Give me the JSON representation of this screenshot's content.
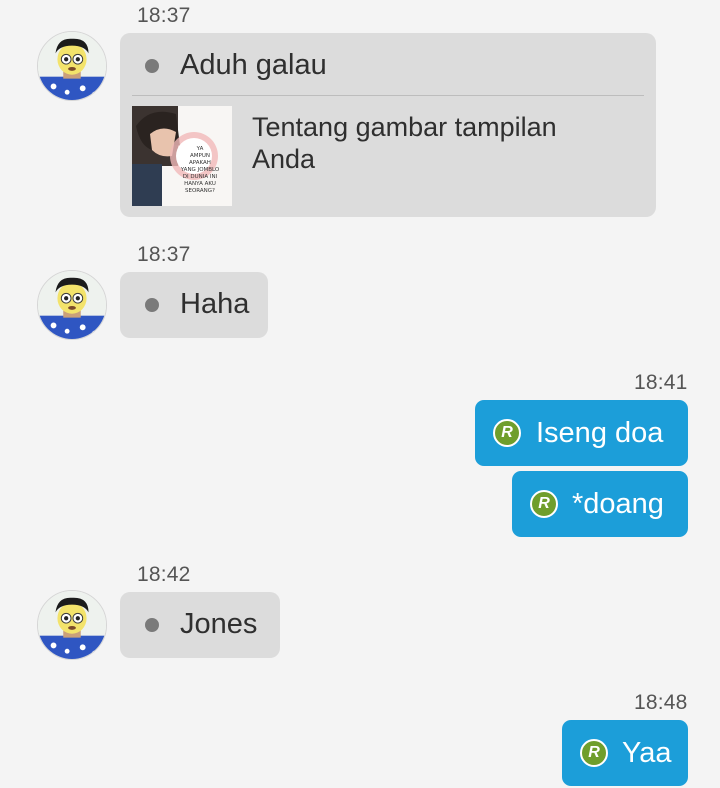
{
  "messages": [
    {
      "time": "18:37",
      "sender": "other",
      "text": "Aduh galau",
      "preview": {
        "title": "Tentang gambar tampilan Anda",
        "thumb_lines": [
          "YA",
          "AMPUN",
          "APAKAH",
          "YANG JOMBLO",
          "DI DUNIA INI",
          "HANYA AKU",
          "SEORANG?"
        ]
      }
    },
    {
      "time": "18:37",
      "sender": "other",
      "text": "Haha"
    },
    {
      "time": "18:41",
      "sender": "me",
      "badge": "R",
      "text": "Iseng doa"
    },
    {
      "sender": "me",
      "badge": "R",
      "text": "*doang"
    },
    {
      "time": "18:42",
      "sender": "other",
      "text": "Jones"
    },
    {
      "time": "18:48",
      "sender": "me",
      "badge": "R",
      "text": "Yaa"
    }
  ],
  "colors": {
    "background": "#f4f4f4",
    "incoming_bubble": "#dcdcdc",
    "outgoing_bubble": "#1c9ed9",
    "badge": "#6f9e2c"
  },
  "icons": {
    "avatar": "avatar-boy-icon",
    "badge": "r-badge-icon",
    "dot": "bullet-dot-icon"
  }
}
